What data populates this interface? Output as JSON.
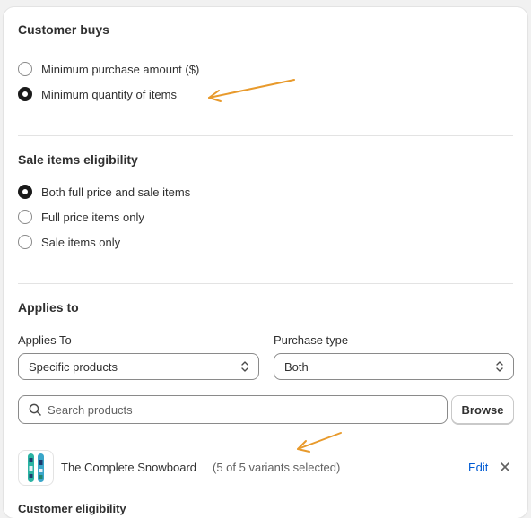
{
  "customer_buys": {
    "title": "Customer buys",
    "options": [
      {
        "label": "Minimum purchase amount ($)",
        "checked": false
      },
      {
        "label": "Minimum quantity of items",
        "checked": true
      }
    ]
  },
  "sale_items": {
    "title": "Sale items eligibility",
    "options": [
      {
        "label": "Both full price and sale items",
        "checked": true
      },
      {
        "label": "Full price items only",
        "checked": false
      },
      {
        "label": "Sale items only",
        "checked": false
      }
    ]
  },
  "applies_to": {
    "title": "Applies to",
    "applies_label": "Applies To",
    "applies_value": "Specific products",
    "purchase_label": "Purchase type",
    "purchase_value": "Both",
    "search_placeholder": "Search products",
    "browse_label": "Browse"
  },
  "product": {
    "name": "The Complete Snowboard",
    "variants": "(5 of 5 variants selected)",
    "edit_label": "Edit",
    "thumb_icon": "snowboard-image"
  },
  "next_section": {
    "title": "Customer eligibility"
  },
  "colors": {
    "accent_link": "#005bd3",
    "annotation_arrow": "#e89a2c",
    "selected_radio": "#1a1a1a"
  }
}
